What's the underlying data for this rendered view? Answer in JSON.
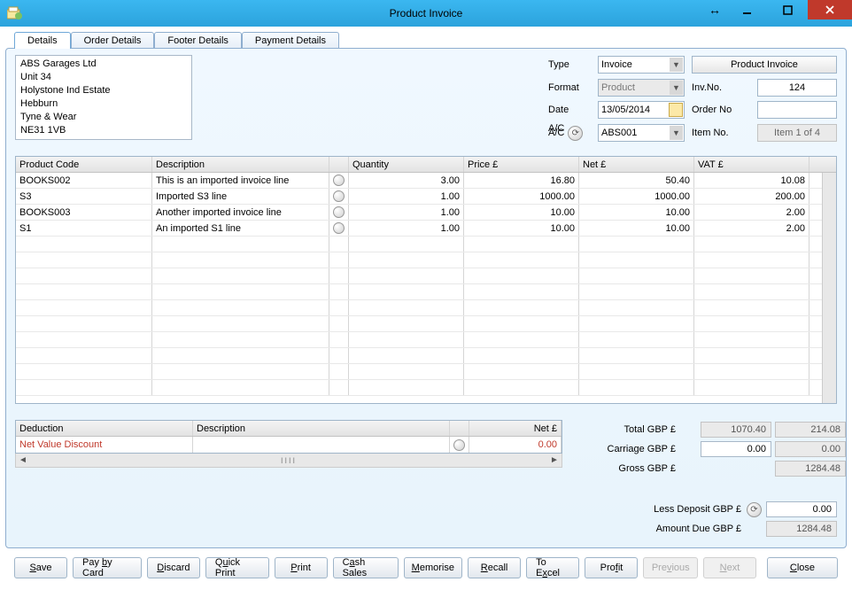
{
  "window": {
    "title": "Product Invoice"
  },
  "tabs": [
    "Details",
    "Order Details",
    "Footer Details",
    "Payment Details"
  ],
  "address": [
    "ABS Garages Ltd",
    "Unit 34",
    "Holystone Ind Estate",
    "Hebburn",
    "Tyne & Wear",
    "NE31 1VB"
  ],
  "header": {
    "type_label": "Type",
    "type_value": "Invoice",
    "product_invoice_btn": "Product Invoice",
    "format_label": "Format",
    "format_value": "Product",
    "invno_label": "Inv.No.",
    "invno_value": "124",
    "date_label": "Date",
    "date_value": "13/05/2014",
    "orderno_label": "Order No",
    "orderno_value": "",
    "ac_label": "A/C",
    "ac_value": "ABS001",
    "itemno_label": "Item No.",
    "itemno_value": "Item 1 of 4"
  },
  "columns": [
    "Product Code",
    "Description",
    "",
    "Quantity",
    "Price £",
    "Net £",
    "VAT £"
  ],
  "rows": [
    {
      "code": "BOOKS002",
      "desc": "This is an imported invoice line",
      "qty": "3.00",
      "price": "16.80",
      "net": "50.40",
      "vat": "10.08"
    },
    {
      "code": "S3",
      "desc": "Imported S3 line",
      "qty": "1.00",
      "price": "1000.00",
      "net": "1000.00",
      "vat": "200.00"
    },
    {
      "code": "BOOKS003",
      "desc": "Another imported invoice line",
      "qty": "1.00",
      "price": "10.00",
      "net": "10.00",
      "vat": "2.00"
    },
    {
      "code": "S1",
      "desc": "An imported S1 line",
      "qty": "1.00",
      "price": "10.00",
      "net": "10.00",
      "vat": "2.00"
    }
  ],
  "deduction": {
    "columns": [
      "Deduction",
      "Description",
      "",
      "Net £"
    ],
    "name": "Net Value Discount",
    "desc": "",
    "net": "0.00"
  },
  "totals": {
    "total_label": "Total GBP £",
    "total_net": "1070.40",
    "total_vat": "214.08",
    "carriage_label": "Carriage GBP £",
    "carriage_net": "0.00",
    "carriage_vat": "0.00",
    "gross_label": "Gross GBP £",
    "gross_value": "1284.48",
    "less_deposit_label": "Less Deposit GBP £",
    "less_deposit_value": "0.00",
    "amount_due_label": "Amount Due GBP £",
    "amount_due_value": "1284.48"
  },
  "buttons": {
    "save": "Save",
    "pay_by_card": "Pay by Card",
    "discard": "Discard",
    "quick_print": "Quick Print",
    "print": "Print",
    "cash_sales": "Cash Sales",
    "memorise": "Memorise",
    "recall": "Recall",
    "to_excel": "To Excel",
    "profit": "Profit",
    "previous": "Previous",
    "next": "Next",
    "close": "Close"
  }
}
